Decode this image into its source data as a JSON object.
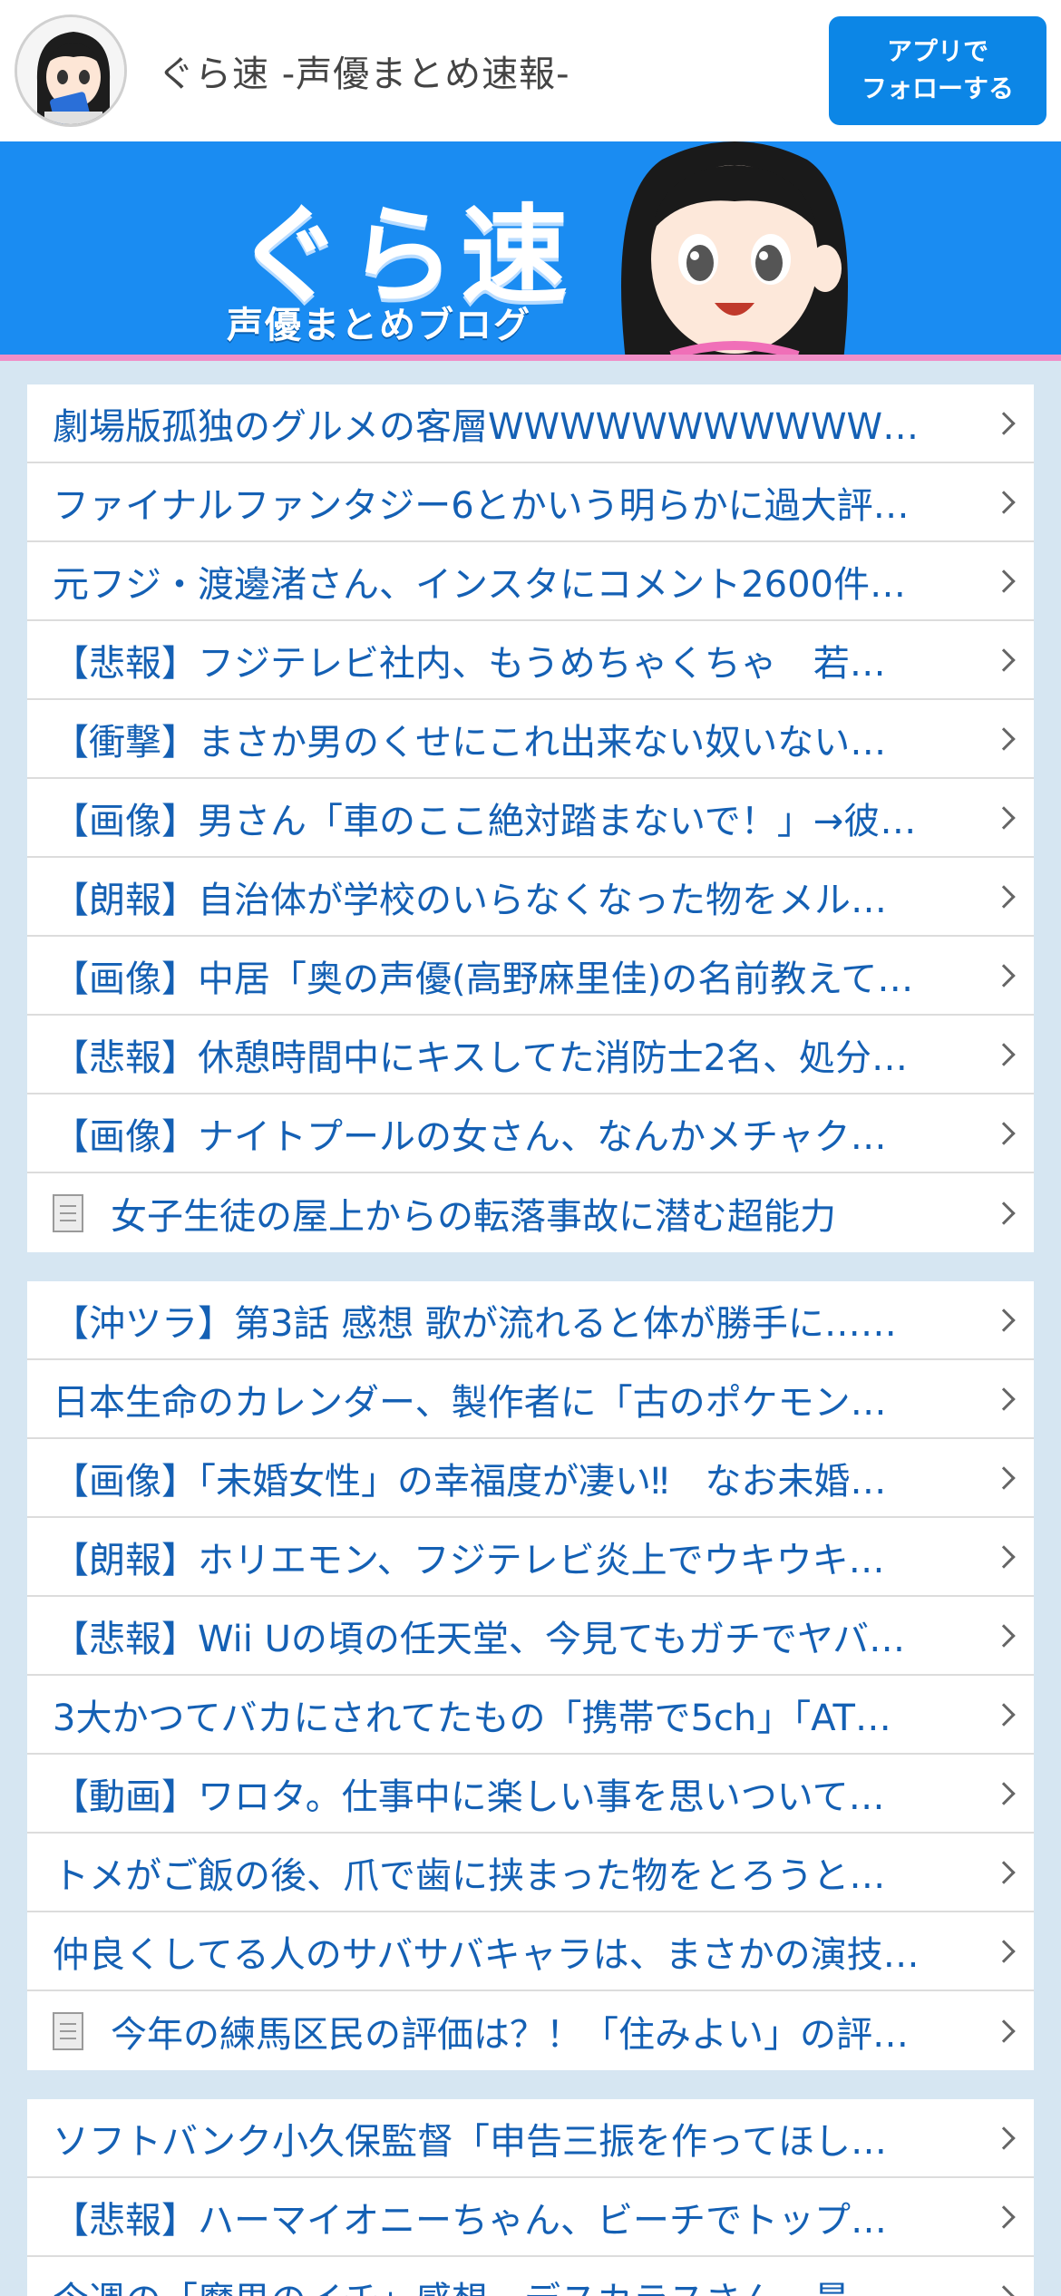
{
  "header": {
    "site_title": "ぐら速 -声優まとめ速報-",
    "follow_button": "アプリで\nフォローする"
  },
  "banner": {
    "logo_text": "ぐら速",
    "subtitle": "声優まとめブログ"
  },
  "lists": [
    {
      "rows": [
        {
          "text": "劇場版孤独のグルメの客層WWWWWWWWWWWW…",
          "icon": null
        },
        {
          "text": "ファイナルファンタジー6とかいう明らかに過大評…",
          "icon": null
        },
        {
          "text": "元フジ・渡邊渚さん、インスタにコメント2600件…",
          "icon": null
        },
        {
          "text": "【悲報】フジテレビ社内、もうめちゃくちゃ　若…",
          "icon": null
        },
        {
          "text": "【衝撃】まさか男のくせにこれ出来ない奴いない…",
          "icon": null
        },
        {
          "text": "【画像】男さん「車のここ絶対踏まないで！」→彼…",
          "icon": null
        },
        {
          "text": "【朗報】自治体が学校のいらなくなった物をメル…",
          "icon": null
        },
        {
          "text": "【画像】中居「奥の声優(高野麻里佳)の名前教えて…",
          "icon": null
        },
        {
          "text": "【悲報】休憩時間中にキスしてた消防士2名、処分…",
          "icon": null
        },
        {
          "text": "【画像】ナイトプールの女さん、なんかメチャク…",
          "icon": null
        },
        {
          "text": "女子生徒の屋上からの転落事故に潜む超能力",
          "icon": "document-icon"
        }
      ]
    },
    {
      "rows": [
        {
          "text": "【沖ツラ】第3話 感想 歌が流れると体が勝手に……",
          "icon": null
        },
        {
          "text": "日本生命のカレンダー、製作者に「古のポケモン…",
          "icon": null
        },
        {
          "text": "【画像】「未婚女性」の幸福度が凄い‼　なお未婚…",
          "icon": null
        },
        {
          "text": "【朗報】ホリエモン、フジテレビ炎上でウキウキ…",
          "icon": null
        },
        {
          "text": "【悲報】Wii Uの頃の任天堂、今見てもガチでヤバ…",
          "icon": null
        },
        {
          "text": "3大かつてバカにされてたもの「携帯で5ch」「AT…",
          "icon": null
        },
        {
          "text": "【動画】ワロタ。仕事中に楽しい事を思いついて…",
          "icon": null
        },
        {
          "text": "トメがご飯の後、爪で歯に挟まった物をとろうと…",
          "icon": null
        },
        {
          "text": "仲良くしてる人のサバサバキャラは、まさかの演技…",
          "icon": null
        },
        {
          "text": "今年の練馬区民の評価は？！「住みよい」の評…",
          "icon": "document-icon"
        }
      ]
    },
    {
      "rows": [
        {
          "text": "ソフトバンク小久保監督「申告三振を作ってほし…",
          "icon": null
        },
        {
          "text": "【悲報】ハーマイオニーちゃん、ビーチでトップ…",
          "icon": null
        },
        {
          "text": "今週の「魔男のイチ」感想　デスカラスさん、最…",
          "icon": null
        }
      ]
    }
  ]
}
